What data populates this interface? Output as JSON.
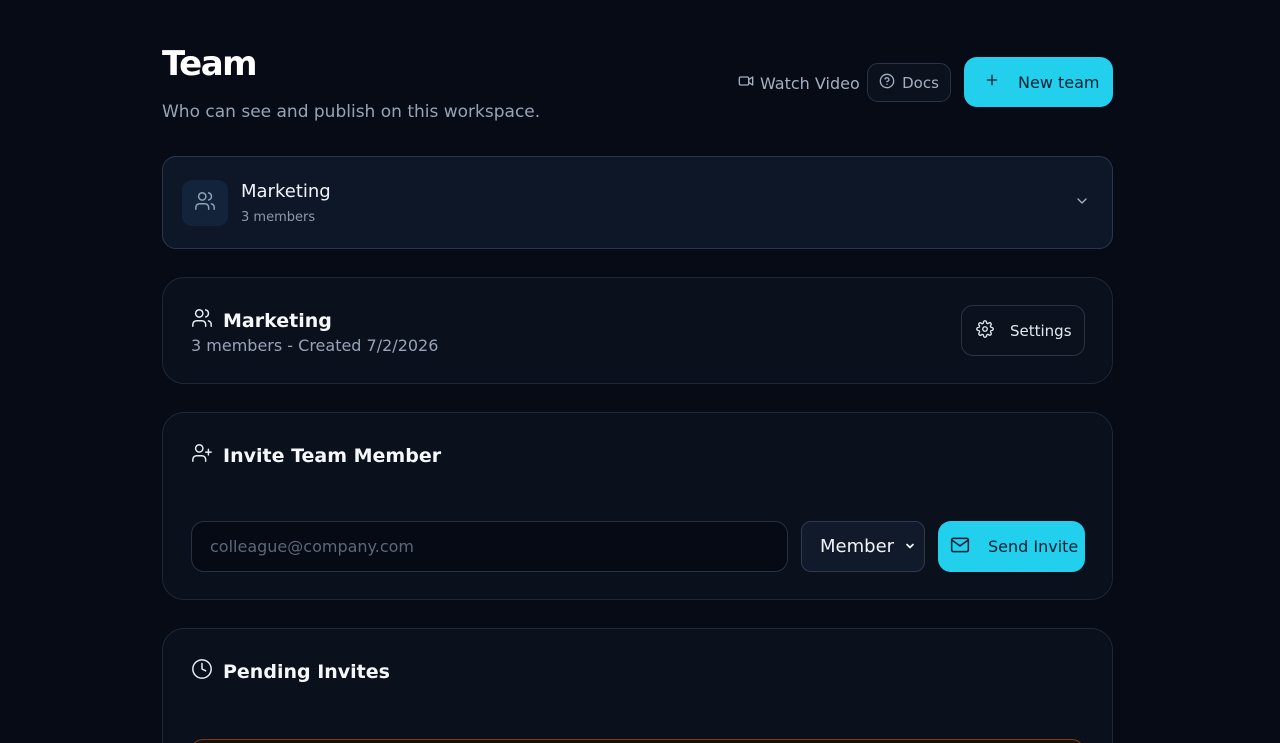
{
  "header": {
    "title": "Team",
    "subtitle": "Who can see and publish on this workspace.",
    "watch_video_label": "Watch Video",
    "docs_label": "Docs",
    "new_team_label": "New team"
  },
  "team_selector": {
    "name": "Marketing",
    "member_count": "3 members"
  },
  "team_info": {
    "name": "Marketing",
    "meta": "3 members - Created 7/2/2026",
    "settings_label": "Settings"
  },
  "invite": {
    "title": "Invite Team Member",
    "email_placeholder": "colleague@company.com",
    "role_selected": "Member",
    "send_label": "Send Invite"
  },
  "pending": {
    "title": "Pending Invites"
  },
  "colors": {
    "accent": "#22cfec",
    "background": "#060b16",
    "card": "#0a101c",
    "warning_border": "#7a3d12"
  },
  "icons": [
    "video-icon",
    "help-circle-icon",
    "plus-icon",
    "users-icon",
    "chevron-down-icon",
    "gear-icon",
    "user-plus-icon",
    "mail-icon",
    "clock-icon"
  ]
}
